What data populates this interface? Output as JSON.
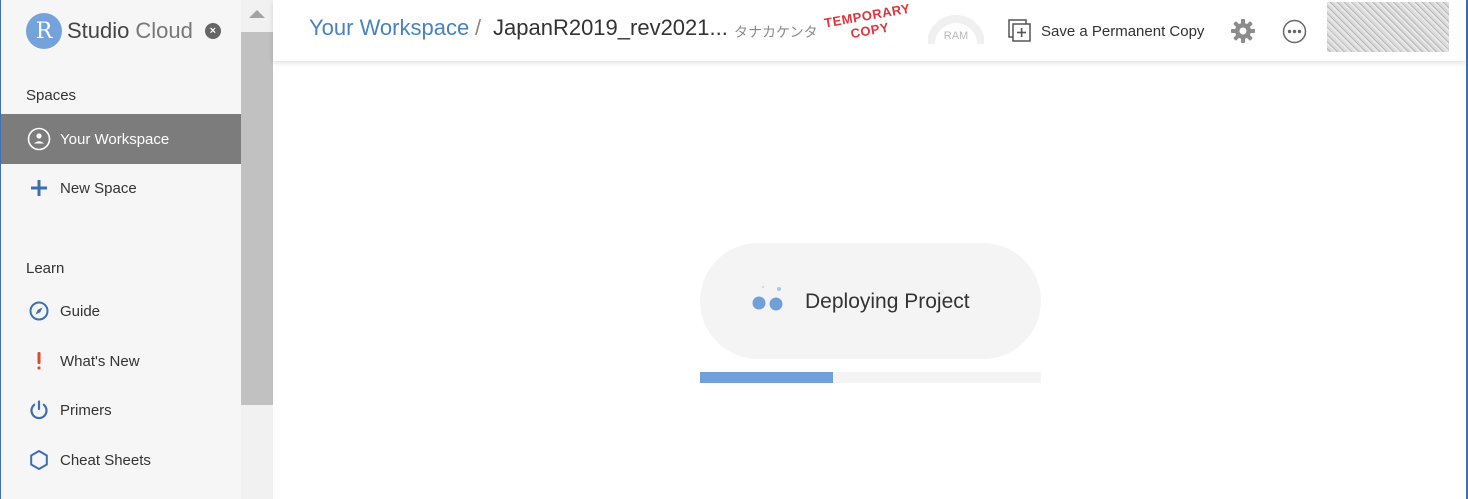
{
  "app": {
    "logo_letter": "R",
    "logo_word1": "Studio",
    "logo_word2": "Cloud",
    "close_glyph": "×"
  },
  "sidebar": {
    "spaces_heading": "Spaces",
    "spaces_items": [
      {
        "label": "Your Workspace",
        "icon": "user-circle-icon",
        "active": true
      },
      {
        "label": "New Space",
        "icon": "plus-icon",
        "active": false
      }
    ],
    "learn_heading": "Learn",
    "learn_items": [
      {
        "label": "Guide",
        "icon": "compass-icon"
      },
      {
        "label": "What's New",
        "icon": "exclamation-icon"
      },
      {
        "label": "Primers",
        "icon": "power-icon"
      },
      {
        "label": "Cheat Sheets",
        "icon": "hexagon-icon"
      }
    ]
  },
  "header": {
    "breadcrumb_workspace": "Your Workspace",
    "breadcrumb_separator": "/",
    "project_title": "JapanR2019_rev2021...",
    "owner": "タナカケンタ",
    "temporary_line1": "TEMPORARY",
    "temporary_line2": "COPY",
    "ram_label": "RAM",
    "save_label": "Save a Permanent Copy"
  },
  "main": {
    "status_text": "Deploying Project",
    "progress_fraction": 0.39
  },
  "colors": {
    "accent": "#4a82bf",
    "sidebar_active": "#7c7c7c",
    "progress": "#6fa0da",
    "temporary": "#e0333d"
  }
}
